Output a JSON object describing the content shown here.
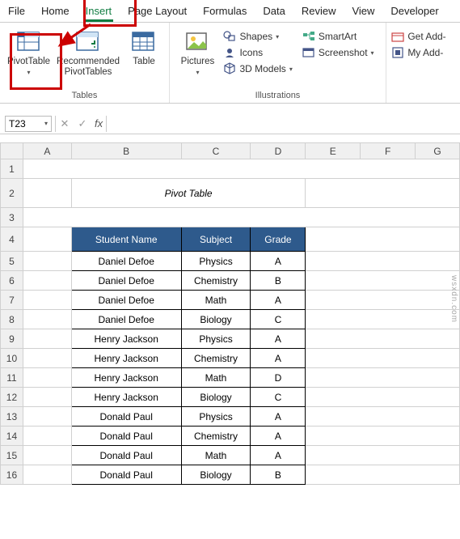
{
  "tabs": [
    "File",
    "Home",
    "Insert",
    "Page Layout",
    "Formulas",
    "Data",
    "Review",
    "View",
    "Developer"
  ],
  "active_tab": "Insert",
  "ribbon": {
    "tables": {
      "label": "Tables",
      "pivot_table": "PivotTable",
      "recommended": "Recommended\nPivotTables",
      "table": "Table"
    },
    "illustrations": {
      "label": "Illustrations",
      "pictures": "Pictures",
      "shapes": "Shapes",
      "icons": "Icons",
      "models": "3D Models",
      "smartart": "SmartArt",
      "screenshot": "Screenshot"
    },
    "addins": {
      "get": "Get Add-",
      "my": "My Add-"
    }
  },
  "namebox": "T23",
  "title": "Pivot Table",
  "headers": {
    "student": "Student Name",
    "subject": "Subject",
    "grade": "Grade"
  },
  "rows": [
    {
      "n": "Daniel Defoe",
      "s": "Physics",
      "g": "A"
    },
    {
      "n": "Daniel Defoe",
      "s": "Chemistry",
      "g": "B"
    },
    {
      "n": "Daniel Defoe",
      "s": "Math",
      "g": "A"
    },
    {
      "n": "Daniel Defoe",
      "s": "Biology",
      "g": "C"
    },
    {
      "n": "Henry Jackson",
      "s": "Physics",
      "g": "A"
    },
    {
      "n": "Henry Jackson",
      "s": "Chemistry",
      "g": "A"
    },
    {
      "n": "Henry Jackson",
      "s": "Math",
      "g": "D"
    },
    {
      "n": "Henry Jackson",
      "s": "Biology",
      "g": "C"
    },
    {
      "n": "Donald Paul",
      "s": "Physics",
      "g": "A"
    },
    {
      "n": "Donald Paul",
      "s": "Chemistry",
      "g": "A"
    },
    {
      "n": "Donald Paul",
      "s": "Math",
      "g": "A"
    },
    {
      "n": "Donald Paul",
      "s": "Biology",
      "g": "B"
    }
  ],
  "cols": [
    "A",
    "B",
    "C",
    "D",
    "E",
    "F",
    "G"
  ],
  "watermark": "wsxdn.com"
}
